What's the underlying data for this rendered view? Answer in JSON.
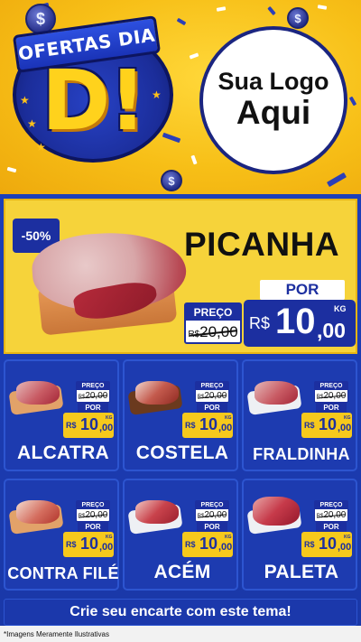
{
  "header": {
    "badge_line1": "OFERTAS DIA",
    "badge_letter": "D!",
    "logo_line1": "Sua Logo",
    "logo_line2": "Aqui",
    "coin_symbol": "$"
  },
  "featured": {
    "discount": "-50%",
    "name": "PICANHA",
    "preco_label": "PREÇO",
    "old_currency": "R$",
    "old_price": "20,00",
    "por_label": "POR",
    "currency": "R$",
    "price_int": "10",
    "price_dec": ",00",
    "unit": "KG"
  },
  "cards": [
    {
      "name": "ALCATRA",
      "preco_label": "PREÇO",
      "old_currency": "R$",
      "old_price": "20,00",
      "por_label": "POR",
      "currency": "R$",
      "price_int": "10",
      "price_dec": ",00",
      "unit": "KG"
    },
    {
      "name": "COSTELA",
      "preco_label": "PREÇO",
      "old_currency": "R$",
      "old_price": "20,00",
      "por_label": "POR",
      "currency": "R$",
      "price_int": "10",
      "price_dec": ",00",
      "unit": "KG"
    },
    {
      "name": "FRALDINHA",
      "preco_label": "PREÇO",
      "old_currency": "R$",
      "old_price": "20,00",
      "por_label": "POR",
      "currency": "R$",
      "price_int": "10",
      "price_dec": ",00",
      "unit": "KG"
    },
    {
      "name": "CONTRA FILÉ",
      "preco_label": "PREÇO",
      "old_currency": "R$",
      "old_price": "20,00",
      "por_label": "POR",
      "currency": "R$",
      "price_int": "10",
      "price_dec": ",00",
      "unit": "KG"
    },
    {
      "name": "ACÉM",
      "preco_label": "PREÇO",
      "old_currency": "R$",
      "old_price": "20,00",
      "por_label": "POR",
      "currency": "R$",
      "price_int": "10",
      "price_dec": ",00",
      "unit": "KG"
    },
    {
      "name": "PALETA",
      "preco_label": "PREÇO",
      "old_currency": "R$",
      "old_price": "20,00",
      "por_label": "POR",
      "currency": "R$",
      "price_int": "10",
      "price_dec": ",00",
      "unit": "KG"
    }
  ],
  "footer": {
    "cta": "Crie seu encarte com este tema!",
    "disclaimer": "*Imagens Meramente Ilustrativas"
  },
  "colors": {
    "brand_blue": "#1c2fa0",
    "body_blue": "#1d3fb8",
    "yellow": "#f6c91c"
  }
}
